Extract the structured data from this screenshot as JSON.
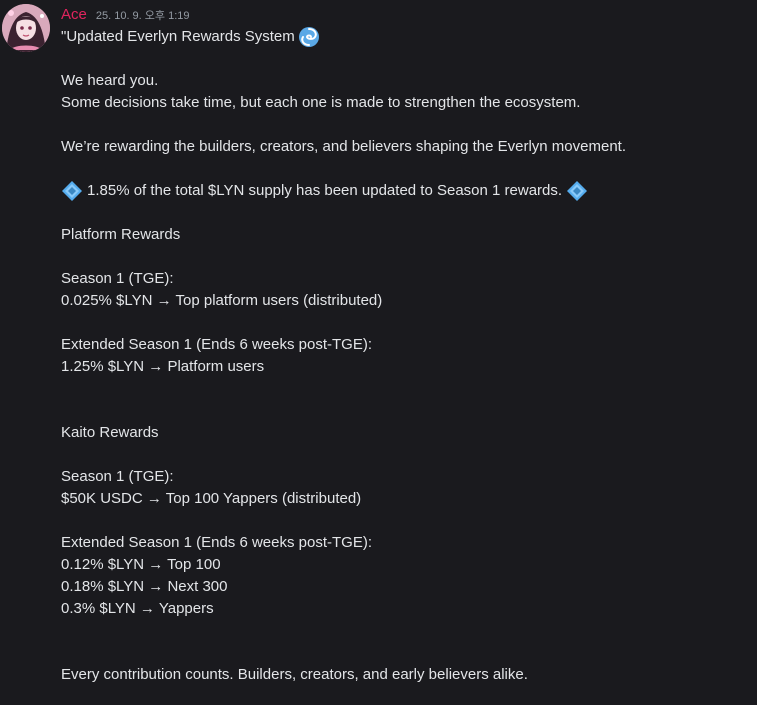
{
  "message": {
    "author": "Ace",
    "author_color": "#e0245e",
    "timestamp": "25. 10. 9. 오후 1:19",
    "avatar_icon": "anime-girl-avatar",
    "lines": {
      "l1": "\"Updated Everlyn Rewards System",
      "l3": "We heard you.",
      "l4": "Some decisions take time, but each one is made to strengthen the ecosystem.",
      "l6": "We’re rewarding the builders, creators, and believers shaping the Everlyn movement.",
      "l8": "1.85% of the total $LYN supply has been updated to Season 1 rewards.",
      "l10": "Platform Rewards",
      "l12": "Season 1 (TGE):",
      "l13": "0.025% $LYN → Top platform users (distributed)",
      "l15": "Extended Season 1 (Ends 6 weeks post-TGE):",
      "l16": "1.25% $LYN → Platform users",
      "l19": "Kaito Rewards",
      "l21": "Season 1 (TGE):",
      "l22": "$50K USDC → Top 100 Yappers (distributed)",
      "l24": "Extended Season 1 (Ends 6 weeks post-TGE):",
      "l25": "0.12% $LYN → Top 100",
      "l26": "0.18% $LYN → Next 300",
      "l27": "0.3% $LYN → Yappers",
      "l30": "Every contribution counts. Builders, creators, and early believers alike."
    },
    "emojis": {
      "cyclone": "cyclone-emoji",
      "diamond": "diamond-with-dot-emoji"
    }
  }
}
